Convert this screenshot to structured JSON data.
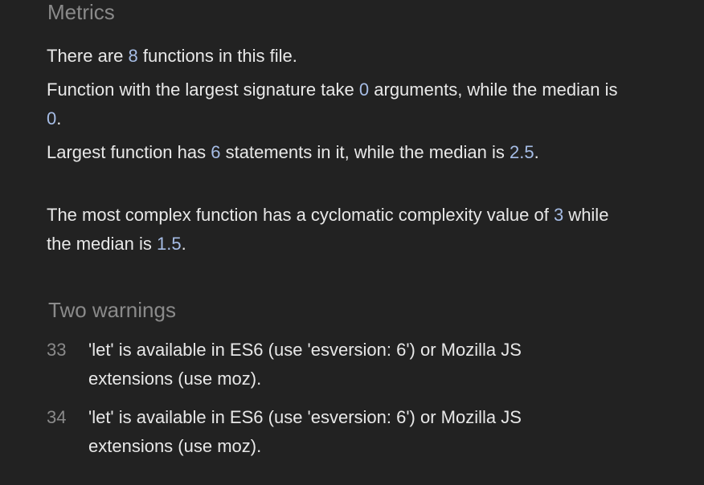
{
  "metrics": {
    "title": "Metrics",
    "functions_sentence": {
      "before": "There are ",
      "count": "8",
      "after": " functions in this file."
    },
    "signature_sentence": {
      "before": "Function with the largest signature take ",
      "largest": "0",
      "middle": " arguments, while the median is ",
      "median": "0",
      "after": "."
    },
    "statements_sentence": {
      "before": "Largest function has ",
      "largest": "6",
      "middle": " statements in it, while the median is ",
      "median": "2.5",
      "after": "."
    },
    "complexity_sentence": {
      "before": "The most complex function has a cyclomatic complexity value of ",
      "largest": "3",
      "middle": " while the median is ",
      "median": "1.5",
      "after": "."
    }
  },
  "warnings": {
    "title": "Two warnings",
    "items": [
      {
        "line": "33",
        "message": "'let' is available in ES6 (use 'esversion: 6') or Mozilla JS extensions (use moz)."
      },
      {
        "line": "34",
        "message": "'let' is available in ES6 (use 'esversion: 6') or Mozilla JS extensions (use moz)."
      }
    ]
  }
}
